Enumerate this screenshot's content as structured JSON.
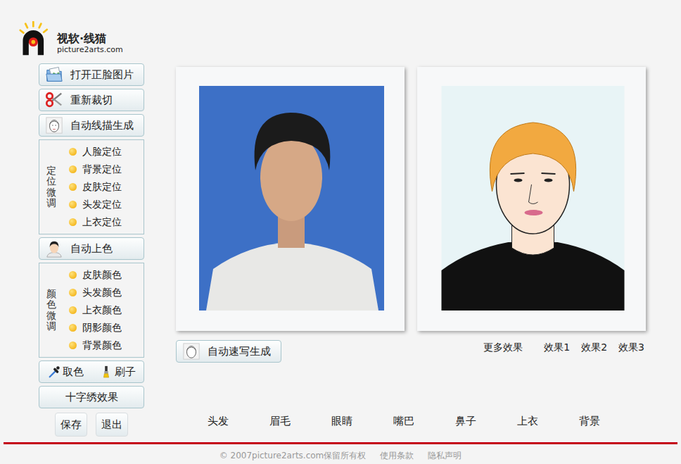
{
  "app": {
    "logo_name": "视软·线猫",
    "logo_url": "picture2arts.com"
  },
  "sidebar": [
    {
      "kind": "button",
      "label": "打开正脸图片"
    },
    {
      "kind": "button",
      "label": "重新裁切"
    },
    {
      "kind": "button",
      "label": "自动线描生成"
    },
    {
      "kind": "group",
      "title": "定位微调",
      "items": [
        "人脸定位",
        "背景定位",
        "皮肤定位",
        "头发定位",
        "上衣定位"
      ]
    },
    {
      "kind": "button",
      "label": "自动上色"
    },
    {
      "kind": "group",
      "title": "颜色微调",
      "items": [
        "皮肤颜色",
        "头发颜色",
        "上衣颜色",
        "阴影颜色",
        "背景颜色"
      ]
    },
    {
      "kind": "tools",
      "items": [
        "取色",
        "刷子"
      ]
    },
    {
      "kind": "plain",
      "label": "十字绣效果"
    },
    {
      "kind": "pair",
      "items": [
        "保存",
        "退出"
      ]
    }
  ],
  "sketch_button": "自动速写生成",
  "effects": {
    "label": "更多效果",
    "options": [
      "效果1",
      "效果2",
      "效果3"
    ]
  },
  "features": [
    "头发",
    "眉毛",
    "眼睛",
    "嘴巴",
    "鼻子",
    "上衣",
    "背景"
  ],
  "footer": {
    "copyright": "© 2007picture2arts.com保留所有权",
    "links": [
      "使用条款",
      "隐私声明"
    ]
  }
}
